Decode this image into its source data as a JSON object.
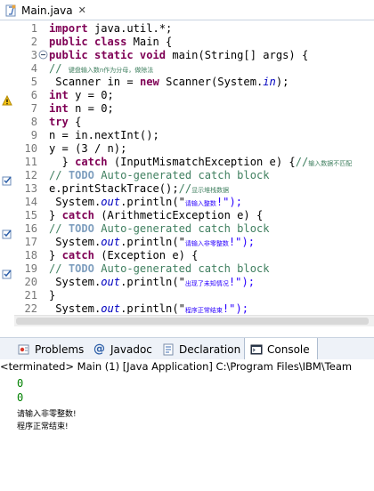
{
  "editor": {
    "tab": {
      "title": "Main.java",
      "close": "✕"
    },
    "lines": [
      {
        "n": "1",
        "segments": [
          {
            "t": "import ",
            "c": "kw"
          },
          {
            "t": "java.util.*;",
            "c": ""
          }
        ]
      },
      {
        "n": "2",
        "segments": [
          {
            "t": "public class ",
            "c": "kw"
          },
          {
            "t": "Main {",
            "c": ""
          }
        ]
      },
      {
        "n": "3",
        "segments": [
          {
            "t": "public static void ",
            "c": "kw"
          },
          {
            "t": "main(String[] args) {",
            "c": ""
          }
        ]
      },
      {
        "n": "4",
        "segments": [
          {
            "t": "// ",
            "c": "cm"
          },
          {
            "t": "键盘输入数n作为分母，做除法",
            "c": "cm small"
          }
        ]
      },
      {
        "n": "5",
        "segments": [
          {
            "t": " Scanner in = ",
            "c": ""
          },
          {
            "t": "new ",
            "c": "kw"
          },
          {
            "t": "Scanner(System.",
            "c": ""
          },
          {
            "t": "in",
            "c": "fld"
          },
          {
            "t": ");",
            "c": ""
          }
        ]
      },
      {
        "n": "6",
        "segments": [
          {
            "t": "int ",
            "c": "kw"
          },
          {
            "t": "y = 0;",
            "c": ""
          }
        ]
      },
      {
        "n": "7",
        "segments": [
          {
            "t": "int ",
            "c": "kw"
          },
          {
            "t": "n = 0;",
            "c": ""
          }
        ]
      },
      {
        "n": "8",
        "segments": [
          {
            "t": "try ",
            "c": "kw"
          },
          {
            "t": "{",
            "c": ""
          }
        ]
      },
      {
        "n": "9",
        "segments": [
          {
            "t": "n = in.nextInt();",
            "c": ""
          }
        ]
      },
      {
        "n": "10",
        "segments": [
          {
            "t": "y = (3 / n);",
            "c": ""
          }
        ]
      },
      {
        "n": "11",
        "segments": [
          {
            "t": "  } ",
            "c": ""
          },
          {
            "t": "catch ",
            "c": "kw"
          },
          {
            "t": "(InputMismatchException e) {",
            "c": ""
          },
          {
            "t": "//",
            "c": "cm"
          },
          {
            "t": "输入数据不匹配",
            "c": "cm small"
          }
        ]
      },
      {
        "n": "12",
        "segments": [
          {
            "t": "// ",
            "c": "cm"
          },
          {
            "t": "TODO ",
            "c": "todo"
          },
          {
            "t": "Auto-generated catch block",
            "c": "cm"
          }
        ]
      },
      {
        "n": "13",
        "segments": [
          {
            "t": "e.printStackTrace();",
            "c": ""
          },
          {
            "t": "//",
            "c": "cm"
          },
          {
            "t": "显示堆栈数据",
            "c": "cm small"
          }
        ]
      },
      {
        "n": "14",
        "segments": [
          {
            "t": " System.",
            "c": ""
          },
          {
            "t": "out",
            "c": "fld"
          },
          {
            "t": ".println(\"",
            "c": ""
          },
          {
            "t": "请输入整数",
            "c": "st small"
          },
          {
            "t": "!\");",
            "c": "st"
          }
        ]
      },
      {
        "n": "15",
        "segments": [
          {
            "t": "} ",
            "c": ""
          },
          {
            "t": "catch ",
            "c": "kw"
          },
          {
            "t": "(ArithmeticException e) {",
            "c": ""
          }
        ]
      },
      {
        "n": "16",
        "segments": [
          {
            "t": "// ",
            "c": "cm"
          },
          {
            "t": "TODO ",
            "c": "todo"
          },
          {
            "t": "Auto-generated catch block",
            "c": "cm"
          }
        ]
      },
      {
        "n": "17",
        "segments": [
          {
            "t": " System.",
            "c": ""
          },
          {
            "t": "out",
            "c": "fld"
          },
          {
            "t": ".println(\"",
            "c": ""
          },
          {
            "t": "请输入非零整数",
            "c": "st small"
          },
          {
            "t": "!\");",
            "c": "st"
          }
        ]
      },
      {
        "n": "18",
        "segments": [
          {
            "t": "} ",
            "c": ""
          },
          {
            "t": "catch ",
            "c": "kw"
          },
          {
            "t": "(Exception e) {",
            "c": ""
          }
        ]
      },
      {
        "n": "19",
        "segments": [
          {
            "t": "// ",
            "c": "cm"
          },
          {
            "t": "TODO ",
            "c": "todo"
          },
          {
            "t": "Auto-generated catch block",
            "c": "cm"
          }
        ]
      },
      {
        "n": "20",
        "segments": [
          {
            "t": " System.",
            "c": ""
          },
          {
            "t": "out",
            "c": "fld"
          },
          {
            "t": ".println(\"",
            "c": ""
          },
          {
            "t": "出现了未知情况",
            "c": "st small"
          },
          {
            "t": "!\");",
            "c": "st"
          }
        ]
      },
      {
        "n": "21",
        "segments": [
          {
            "t": "}",
            "c": ""
          }
        ]
      },
      {
        "n": "22",
        "segments": [
          {
            "t": " System.",
            "c": ""
          },
          {
            "t": "out",
            "c": "fld"
          },
          {
            "t": ".println(\"",
            "c": ""
          },
          {
            "t": "程序正常结束",
            "c": "st small"
          },
          {
            "t": "!\");",
            "c": "st"
          }
        ]
      }
    ]
  },
  "views": {
    "tabs": [
      "Problems",
      "Javadoc",
      "Declaration",
      "Console"
    ],
    "active": "Console",
    "console_header": "<terminated> Main (1) [Java Application] C:\\Program Files\\IBM\\Team",
    "output": [
      "0",
      "0",
      "请输入非零整数!",
      "程序正常结束!"
    ]
  },
  "colors": {
    "keyword": "#7f0055",
    "comment": "#3f7f5f",
    "string": "#2a00ff",
    "todo": "#7f9fbf",
    "console_number": "#008000"
  }
}
